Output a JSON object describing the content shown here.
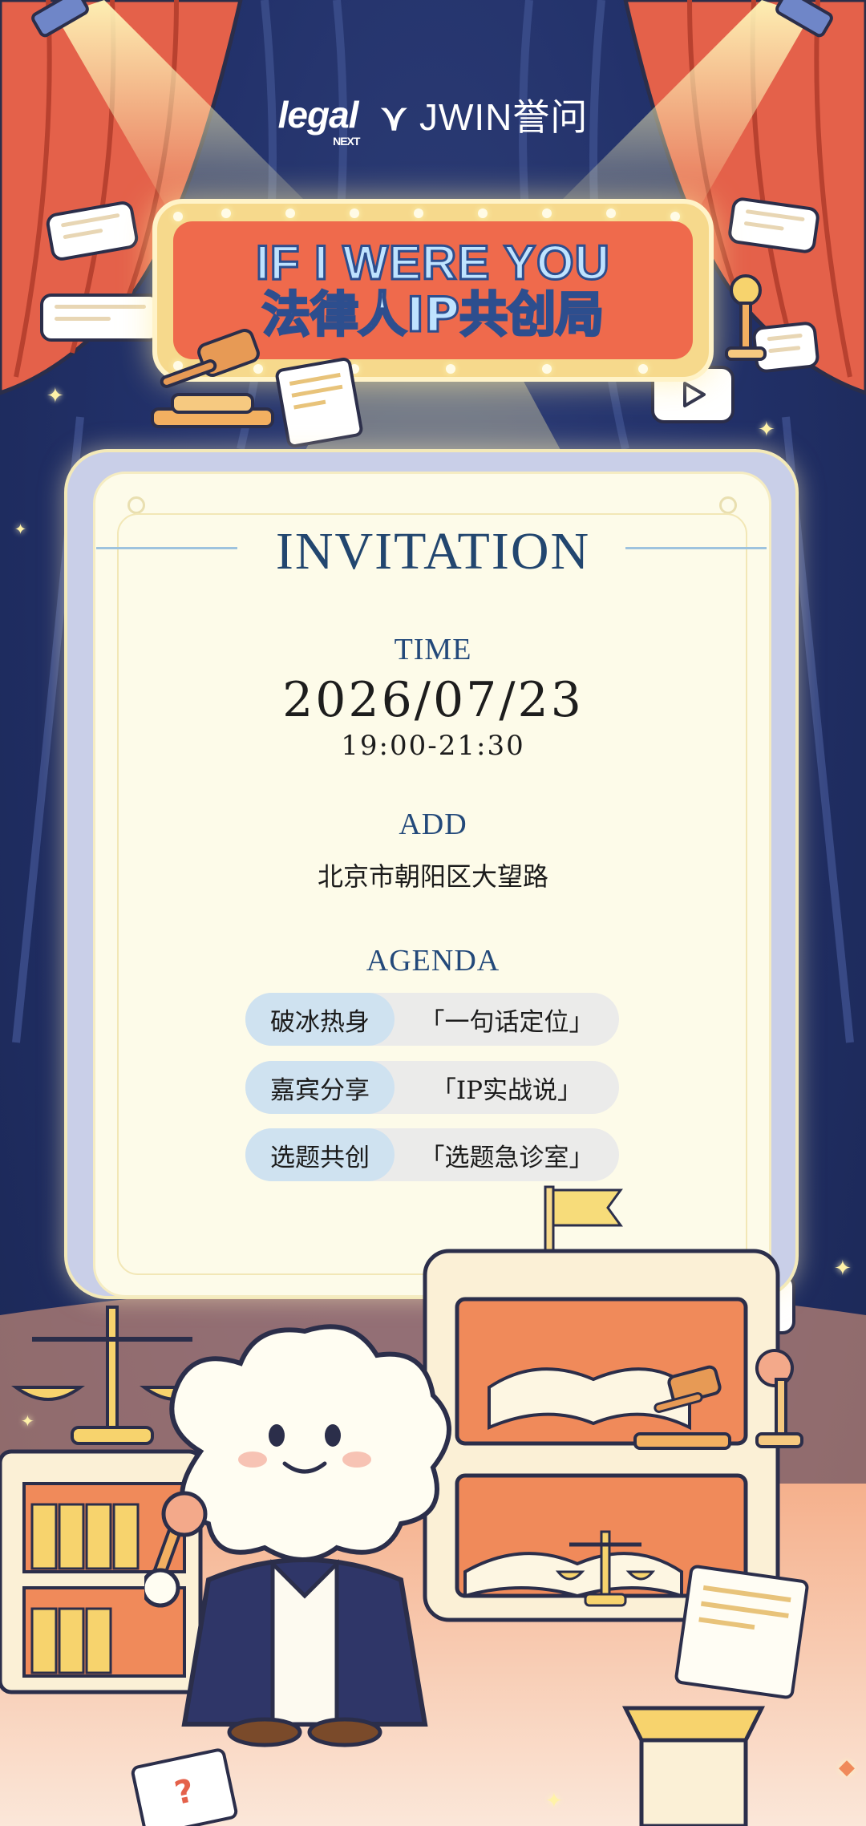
{
  "brand": {
    "logo1": "legal",
    "logo1_sub": "NEXT",
    "logo2": "JWIN誉问"
  },
  "sign": {
    "line1": "IF I WERE YOU",
    "line2": "法律人IP共创局"
  },
  "invitation": {
    "title": "INVITATION",
    "time_label": "TIME",
    "date": "2026/07/23",
    "time_range": "19:00-21:30",
    "address_label": "ADD",
    "address": "北京市朝阳区大望路",
    "agenda_label": "AGENDA",
    "agenda": [
      {
        "tag": "破冰热身",
        "item": "「一句话定位」"
      },
      {
        "tag": "嘉宾分享",
        "item": "「IP实战说」"
      },
      {
        "tag": "选题共创",
        "item": "「选题急诊室」"
      }
    ]
  },
  "icons": {
    "play": "play-icon",
    "gavel": "gavel-icon",
    "scales": "scales-icon",
    "microphone": "microphone-icon",
    "book": "book-icon",
    "flag": "flag-icon",
    "spotlight": "spotlight-icon",
    "mascot": "cloud-mascot"
  },
  "colors": {
    "background": "#22316a",
    "curtain": "#e4614a",
    "sign_red": "#ef6a4c",
    "sign_text": "#bfe3ff",
    "card": "#fdfbe9",
    "title": "#22466f",
    "tag": "#cfe2f0",
    "pill": "#ebebea"
  }
}
